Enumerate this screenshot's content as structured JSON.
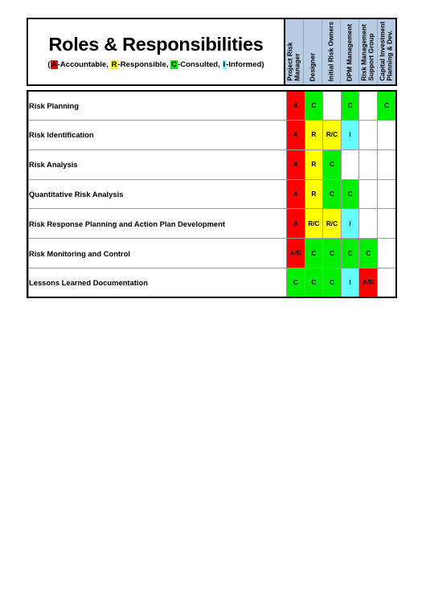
{
  "document": {
    "title": "Roles & Responsibilities",
    "legend": {
      "open_paren": "(",
      "items": [
        {
          "key": "A",
          "label": "-Accountable, ",
          "color": "#FF0000"
        },
        {
          "key": "R",
          "label": "-Responsible, ",
          "color": "#FFFF00"
        },
        {
          "key": "C",
          "label": "-Consulted, ",
          "color": "#00EE00"
        },
        {
          "key": "I",
          "label": "-Informed",
          "color": "#66FFFF"
        }
      ],
      "close_paren": ")"
    }
  },
  "columns": [
    {
      "id": "project-risk-manager",
      "line1": "Project  Risk",
      "line2": "Manager"
    },
    {
      "id": "designer",
      "line1": "Designer",
      "line2": ""
    },
    {
      "id": "initial-risk-owners",
      "line1": "Initial Risk Owners",
      "line2": ""
    },
    {
      "id": "dpm-management",
      "line1": "DPM Management",
      "line2": ""
    },
    {
      "id": "risk-management-support-group",
      "line1": "Risk Management",
      "line2": "Support Group"
    },
    {
      "id": "capital-investment-planning-dev",
      "line1": "Capital Investment",
      "line2": "Planning & Dev."
    }
  ],
  "colors": {
    "accountable": "#FF0000",
    "responsible": "#FFFF00",
    "consulted": "#00EE00",
    "informed": "#66FFFF",
    "header_band": "#b8cce4",
    "empty": "#FFFFFF",
    "grid": "#9A9A9A",
    "outline": "#000000"
  },
  "rows": [
    {
      "task": "Risk Planning",
      "cells": [
        {
          "text": "A",
          "fill": "red"
        },
        {
          "text": "C",
          "fill": "grn"
        },
        {
          "text": "",
          "fill": "none"
        },
        {
          "text": "C",
          "fill": "grn"
        },
        {
          "text": "",
          "fill": "none"
        },
        {
          "text": "C",
          "fill": "grn"
        }
      ]
    },
    {
      "task": "Risk Identification",
      "cells": [
        {
          "text": "A",
          "fill": "red"
        },
        {
          "text": "R",
          "fill": "yel"
        },
        {
          "text": "R/C",
          "fill": "yel"
        },
        {
          "text": "I",
          "fill": "cyn"
        },
        {
          "text": "",
          "fill": "none"
        },
        {
          "text": "",
          "fill": "none"
        }
      ]
    },
    {
      "task": "Risk Analysis",
      "cells": [
        {
          "text": "A",
          "fill": "red"
        },
        {
          "text": "R",
          "fill": "yel"
        },
        {
          "text": "C",
          "fill": "grn"
        },
        {
          "text": "",
          "fill": "none"
        },
        {
          "text": "",
          "fill": "none"
        },
        {
          "text": "",
          "fill": "none"
        }
      ]
    },
    {
      "task": "Quantitative Risk Analysis",
      "cells": [
        {
          "text": "A",
          "fill": "red"
        },
        {
          "text": "R",
          "fill": "yel"
        },
        {
          "text": "C",
          "fill": "grn"
        },
        {
          "text": "C",
          "fill": "grn"
        },
        {
          "text": "",
          "fill": "none"
        },
        {
          "text": "",
          "fill": "none"
        }
      ]
    },
    {
      "task": "Risk Response Planning and Action Plan Development",
      "cells": [
        {
          "text": "A",
          "fill": "red"
        },
        {
          "text": "R/C",
          "fill": "yel"
        },
        {
          "text": "R/C",
          "fill": "yel"
        },
        {
          "text": "I",
          "fill": "cyn"
        },
        {
          "text": "",
          "fill": "none"
        },
        {
          "text": "",
          "fill": "none"
        }
      ]
    },
    {
      "task": "Risk Monitoring and Control",
      "cells": [
        {
          "text": "A/R",
          "fill": "red"
        },
        {
          "text": "C",
          "fill": "grn"
        },
        {
          "text": "C",
          "fill": "grn"
        },
        {
          "text": "C",
          "fill": "grn"
        },
        {
          "text": "C",
          "fill": "grn"
        },
        {
          "text": "",
          "fill": "none"
        }
      ]
    },
    {
      "task": "Lessons Learned Documentation",
      "cells": [
        {
          "text": "C",
          "fill": "grn"
        },
        {
          "text": "C",
          "fill": "grn"
        },
        {
          "text": "C",
          "fill": "grn"
        },
        {
          "text": "I",
          "fill": "cyn"
        },
        {
          "text": "A/R",
          "fill": "red"
        },
        {
          "text": "",
          "fill": "none"
        }
      ]
    }
  ]
}
